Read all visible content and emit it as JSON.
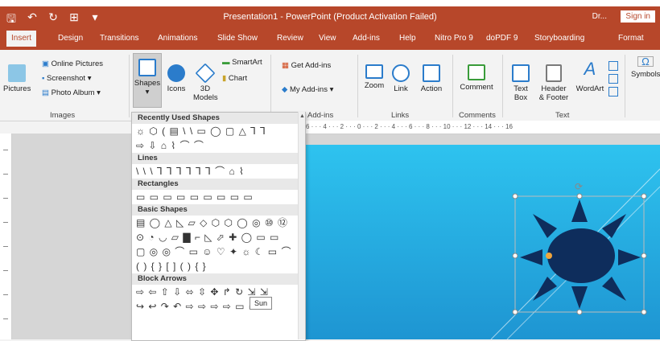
{
  "window": {
    "title": "Presentation1  -  PowerPoint (Product Activation Failed)",
    "user": "Dr...",
    "sign_in": "Sign in"
  },
  "tabs": [
    "Insert",
    "Design",
    "Transitions",
    "Animations",
    "Slide Show",
    "Review",
    "View",
    "Add-ins",
    "Help",
    "Nitro Pro 9",
    "doPDF 9",
    "Storyboarding",
    "Format"
  ],
  "ribbon": {
    "images_group": {
      "label": "Images",
      "pictures": "Pictures",
      "online_pictures": "Online Pictures",
      "screenshot": "Screenshot ▾",
      "photo_album": "Photo Album ▾"
    },
    "illustrations": {
      "shapes": "Shapes",
      "icons": "Icons",
      "models_line1": "3D",
      "models_line2": "Models",
      "smartart": "SmartArt",
      "chart": "Chart"
    },
    "addins": {
      "get": "Get Add-ins",
      "my": "My Add-ins ▾",
      "label": "Add-ins"
    },
    "links": {
      "zoom": "Zoom",
      "link": "Link",
      "action": "Action",
      "label": "Links"
    },
    "comments": {
      "comment": "Comment",
      "label": "Comments"
    },
    "text": {
      "textbox_line1": "Text",
      "textbox_line2": "Box",
      "header_line1": "Header",
      "header_line2": "& Footer",
      "wordart": "WordArt",
      "label": "Text"
    },
    "symbols": {
      "label": "Symbols"
    }
  },
  "ruler": "6 · · · 4 · · · 2 · · · 0 · · · 2 · · · 4 · · · 6 · · · 8 · · · 10 · · · 12 · · · 14 · · · 16",
  "gallery": {
    "sections": [
      {
        "title": "Recently Used Shapes",
        "rows": [
          "☼ ⬡ ( ▤ \\ \\ ▭ ◯ ▢ △ ⅂ ⅂",
          "⇨ ⇩ ⌂ ⌇ ⌒ ⌒"
        ]
      },
      {
        "title": "Lines",
        "rows": [
          "\\ \\ \\ ⅂ ⅂ ⅂ ⅂ ⅂ ⅂ ⌒ ⌂ ⌇"
        ]
      },
      {
        "title": "Rectangles",
        "rows": [
          "▭ ▭ ▭ ▭ ▭ ▭ ▭ ▭ ▭"
        ]
      },
      {
        "title": "Basic Shapes",
        "rows": [
          "▤ ◯ △ ◺ ▱ ◇ ⬡ ⬡ ◯ ◎ ⑩ ⑫",
          "⊙ ◔ ◡ ▱ ▇ ⌐ ◺ ⬀ ✚ ◯ ▭ ▭",
          "▢ ◎ ◎ ⌒ ▭ ☺ ♡ ✦ ☼ ☾ ▭ ⌒",
          "( ) { } [ ] ( ) { }"
        ]
      },
      {
        "title": "Block Arrows",
        "rows": [
          "⇨ ⇦ ⇧ ⇩ ⬄ ⇳ ✥ ↱ ↻ ⇲ ⇲",
          "↪ ↩ ↷ ↶ ⇨ ⇨ ⇨ ⇨ ▭ ▭ ▭"
        ]
      }
    ],
    "tooltip": "Sun"
  },
  "colors": {
    "accent": "#b7472a",
    "slide_top": "#2ec3ef",
    "slide_bottom": "#1e95d2",
    "sun": "#0e2d5c",
    "handle": "#f0a53c"
  }
}
